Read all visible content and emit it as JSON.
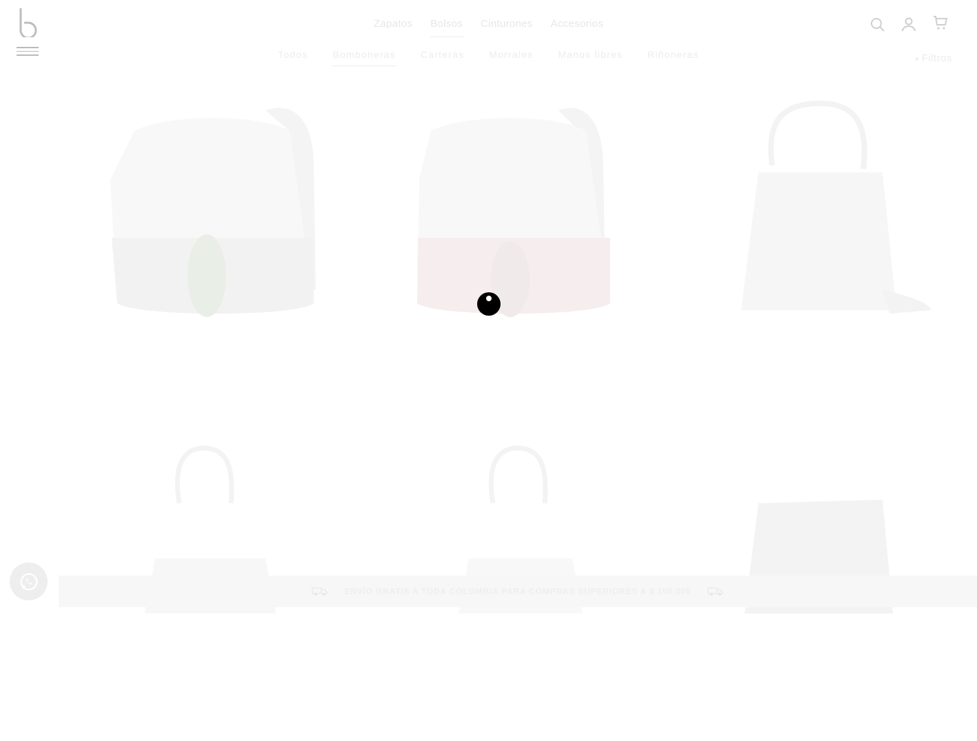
{
  "header": {
    "logo": "b",
    "main_nav": [
      {
        "label": "Zapatos",
        "active": false
      },
      {
        "label": "Bolsos",
        "active": true
      },
      {
        "label": "Cinturones",
        "active": false
      },
      {
        "label": "Accesorios",
        "active": false
      }
    ],
    "sub_nav": [
      {
        "label": "Todos",
        "active": false
      },
      {
        "label": "Bomboneras",
        "active": true
      },
      {
        "label": "Carteras",
        "active": false
      },
      {
        "label": "Morrales",
        "active": false
      },
      {
        "label": "Manos libres",
        "active": false
      },
      {
        "label": "Riñoneras",
        "active": false
      }
    ],
    "icons": [
      "search-icon",
      "user-icon",
      "cart-icon",
      "hamburger-menu-icon"
    ],
    "filters_label": "Filtros"
  },
  "products": [
    {
      "name": "bucket-bag-white-woven-green-tassel"
    },
    {
      "name": "bucket-bag-white-woven-red-tassel"
    },
    {
      "name": "bucket-bag-gray-top-handle"
    },
    {
      "name": "tote-bag-white-top-handle"
    },
    {
      "name": "tote-bag-white-knot-handle"
    },
    {
      "name": "bag-patterned-woven"
    }
  ],
  "shipping_bar": {
    "text": "ENVÍO GRATIS A TODA COLOMBIA PARA COMPRAS SUPERIORES A $ 100.000",
    "icons": [
      "truck-icon",
      "truck-icon"
    ]
  },
  "colors": {
    "accent": "#000000",
    "faded_text": "#e7e7e7",
    "bar_bg": "#f7f7f7"
  }
}
